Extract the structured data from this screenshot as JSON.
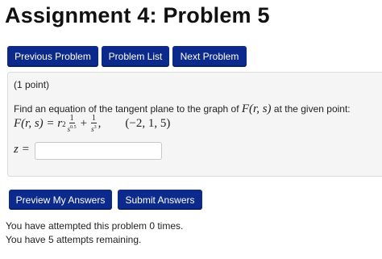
{
  "page": {
    "title": "Assignment 4: Problem 5"
  },
  "nav": {
    "previous_label": "Previous Problem",
    "list_label": "Problem List",
    "next_label": "Next Problem"
  },
  "problem": {
    "points": "(1 point)",
    "statement_prefix": "Find an equation of the tangent plane to the graph of ",
    "statement_function": "F(r, s)",
    "statement_suffix": " at the given point:",
    "formula_lhs": "F(r, s) = r",
    "formula_r_exp": "2",
    "frac1_num": "1",
    "frac1_den_base": "s",
    "frac1_den_exp": "0.5",
    "plus": "+",
    "frac2_num": "1",
    "frac2_den_base": "s",
    "frac2_den_exp": "3",
    "comma": ",",
    "point": "(−2, 1, 5)",
    "answer_label": "z =",
    "answer_value": ""
  },
  "actions": {
    "preview_label": "Preview My Answers",
    "submit_label": "Submit Answers"
  },
  "status": {
    "attempted": "You have attempted this problem 0 times.",
    "remaining": "You have 5 attempts remaining."
  },
  "colors": {
    "button_bg": "#0b2a8c",
    "panel_bg": "#f5f5f5"
  }
}
